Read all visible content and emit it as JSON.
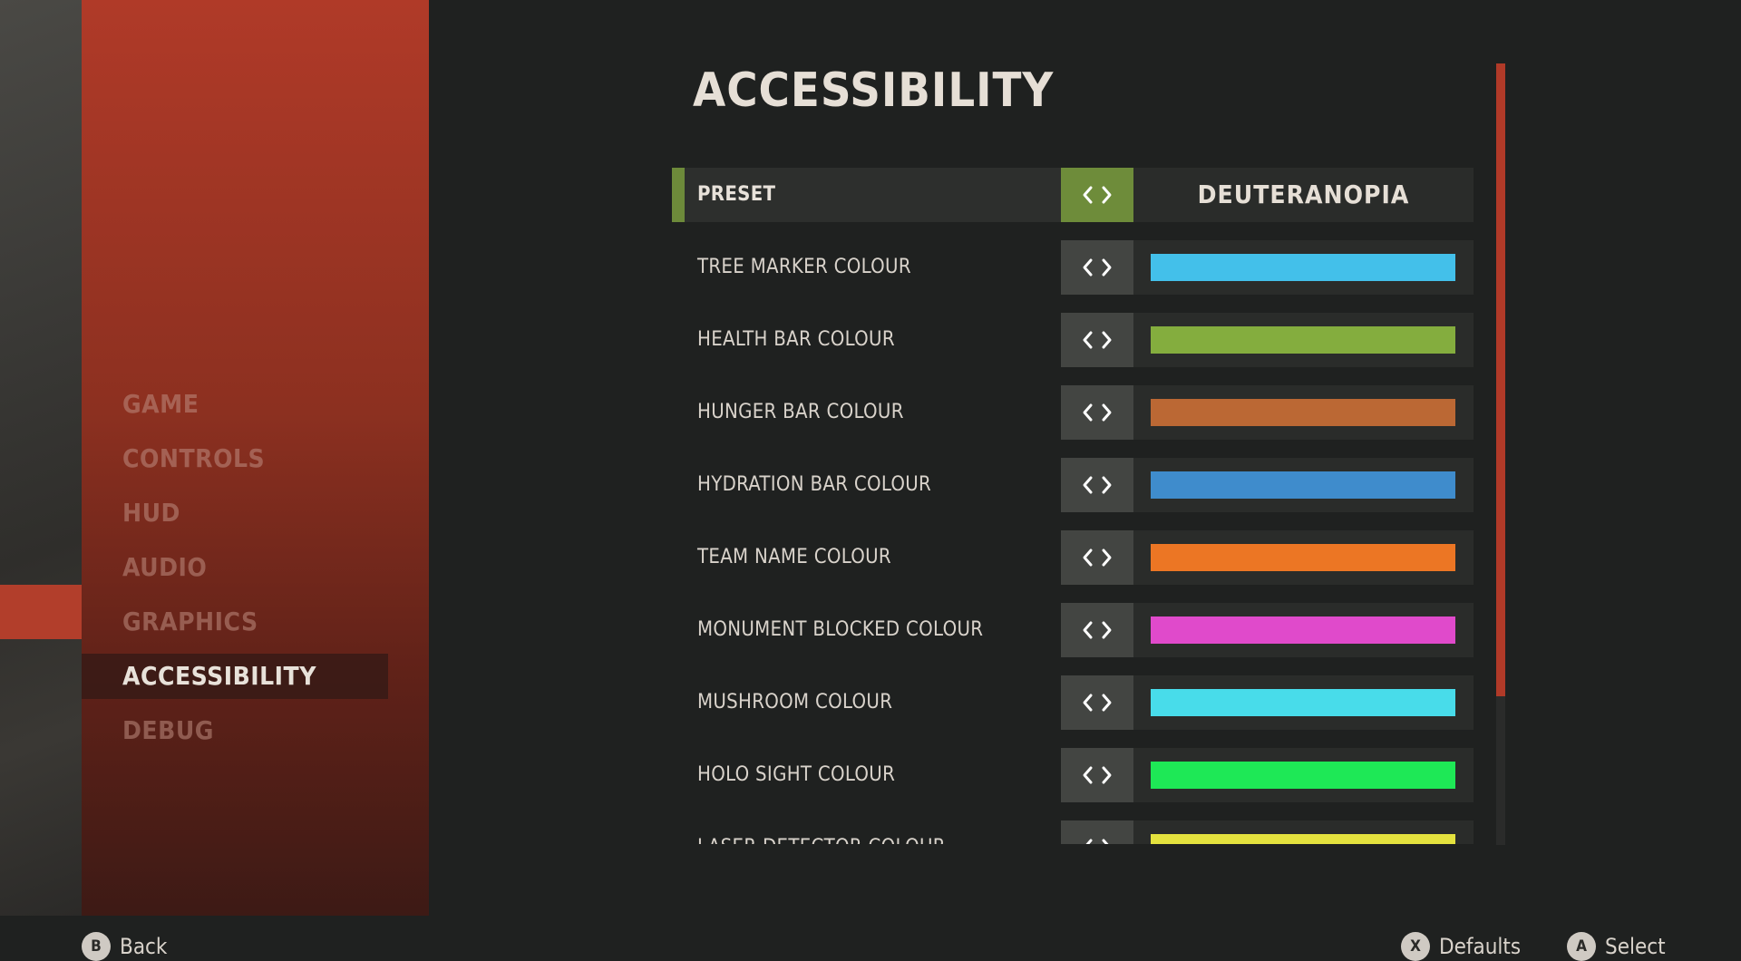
{
  "sidebar": {
    "items": [
      {
        "label": "GAME"
      },
      {
        "label": "CONTROLS"
      },
      {
        "label": "HUD"
      },
      {
        "label": "AUDIO"
      },
      {
        "label": "GRAPHICS"
      },
      {
        "label": "ACCESSIBILITY",
        "active": true
      },
      {
        "label": "DEBUG"
      }
    ]
  },
  "page": {
    "title": "ACCESSIBILITY"
  },
  "settings": {
    "preset": {
      "label": "PRESET",
      "value": "DEUTERANOPIA"
    },
    "rows": [
      {
        "label": "TREE MARKER COLOUR",
        "color": "#43c0ea"
      },
      {
        "label": "HEALTH BAR COLOUR",
        "color": "#84ad3e"
      },
      {
        "label": "HUNGER BAR COLOUR",
        "color": "#bb6834"
      },
      {
        "label": "HYDRATION BAR COLOUR",
        "color": "#3f8ccc"
      },
      {
        "label": "TEAM NAME COLOUR",
        "color": "#ec7624"
      },
      {
        "label": "MONUMENT BLOCKED COLOUR",
        "color": "#e04acb"
      },
      {
        "label": "MUSHROOM COLOUR",
        "color": "#48dcea"
      },
      {
        "label": "HOLO SIGHT COLOUR",
        "color": "#1ee856"
      },
      {
        "label": "LASER DETECTOR COLOUR",
        "color": "#e4e23e"
      }
    ]
  },
  "scroll": {
    "position": 0,
    "visible_fraction": 0.81
  },
  "footer": {
    "back": {
      "key": "B",
      "label": "Back"
    },
    "defaults": {
      "key": "X",
      "label": "Defaults"
    },
    "select": {
      "key": "A",
      "label": "Select"
    }
  },
  "colors": {
    "accent_red": "#b03a28",
    "accent_green": "#6e8c3a",
    "background": "#1f2120"
  }
}
